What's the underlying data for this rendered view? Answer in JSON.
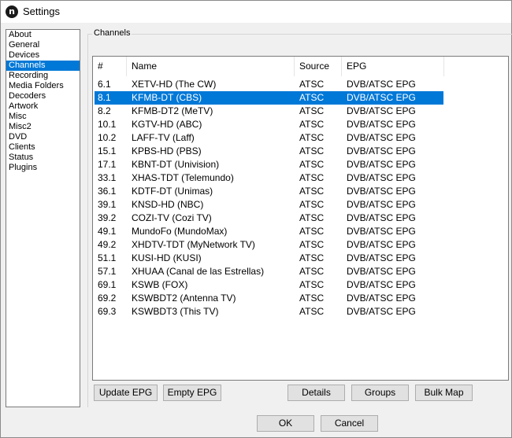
{
  "window": {
    "title": "Settings",
    "icon_letter": "n"
  },
  "nav": {
    "items": [
      "About",
      "General",
      "Devices",
      "Channels",
      "Recording",
      "Media Folders",
      "Decoders",
      "Artwork",
      "Misc",
      "Misc2",
      "DVD",
      "Clients",
      "Status",
      "Plugins"
    ],
    "selected": "Channels"
  },
  "channels": {
    "group_label": "Channels",
    "columns": {
      "num": "#",
      "name": "Name",
      "source": "Source",
      "epg": "EPG"
    },
    "rows": [
      {
        "num": "6.1",
        "name": "XETV-HD (The CW)",
        "source": "ATSC",
        "epg": "DVB/ATSC EPG"
      },
      {
        "num": "8.1",
        "name": "KFMB-DT (CBS)",
        "source": "ATSC",
        "epg": "DVB/ATSC EPG"
      },
      {
        "num": "8.2",
        "name": "KFMB-DT2 (MeTV)",
        "source": "ATSC",
        "epg": "DVB/ATSC EPG"
      },
      {
        "num": "10.1",
        "name": "KGTV-HD (ABC)",
        "source": "ATSC",
        "epg": "DVB/ATSC EPG"
      },
      {
        "num": "10.2",
        "name": "LAFF-TV (Laff)",
        "source": "ATSC",
        "epg": "DVB/ATSC EPG"
      },
      {
        "num": "15.1",
        "name": "KPBS-HD (PBS)",
        "source": "ATSC",
        "epg": "DVB/ATSC EPG"
      },
      {
        "num": "17.1",
        "name": "KBNT-DT (Univision)",
        "source": "ATSC",
        "epg": "DVB/ATSC EPG"
      },
      {
        "num": "33.1",
        "name": "XHAS-TDT (Telemundo)",
        "source": "ATSC",
        "epg": "DVB/ATSC EPG"
      },
      {
        "num": "36.1",
        "name": "KDTF-DT (Unimas)",
        "source": "ATSC",
        "epg": "DVB/ATSC EPG"
      },
      {
        "num": "39.1",
        "name": "KNSD-HD (NBC)",
        "source": "ATSC",
        "epg": "DVB/ATSC EPG"
      },
      {
        "num": "39.2",
        "name": "COZI-TV (Cozi TV)",
        "source": "ATSC",
        "epg": "DVB/ATSC EPG"
      },
      {
        "num": "49.1",
        "name": "MundoFo (MundoMax)",
        "source": "ATSC",
        "epg": "DVB/ATSC EPG"
      },
      {
        "num": "49.2",
        "name": "XHDTV-TDT (MyNetwork TV)",
        "source": "ATSC",
        "epg": "DVB/ATSC EPG"
      },
      {
        "num": "51.1",
        "name": "KUSI-HD (KUSI)",
        "source": "ATSC",
        "epg": "DVB/ATSC EPG"
      },
      {
        "num": "57.1",
        "name": "XHUAA (Canal de las Estrellas)",
        "source": "ATSC",
        "epg": "DVB/ATSC EPG"
      },
      {
        "num": "69.1",
        "name": "KSWB (FOX)",
        "source": "ATSC",
        "epg": "DVB/ATSC EPG"
      },
      {
        "num": "69.2",
        "name": "KSWBDT2 (Antenna TV)",
        "source": "ATSC",
        "epg": "DVB/ATSC EPG"
      },
      {
        "num": "69.3",
        "name": "KSWBDT3 (This TV)",
        "source": "ATSC",
        "epg": "DVB/ATSC EPG"
      }
    ],
    "selected_num": "8.1",
    "buttons": {
      "update_epg": "Update EPG",
      "empty_epg": "Empty EPG",
      "details": "Details",
      "groups": "Groups",
      "bulk_map": "Bulk Map"
    }
  },
  "dialog": {
    "ok": "OK",
    "cancel": "Cancel"
  },
  "colors": {
    "selection": "#0078d7",
    "face": "#f0f0f0",
    "button": "#e1e1e1"
  }
}
